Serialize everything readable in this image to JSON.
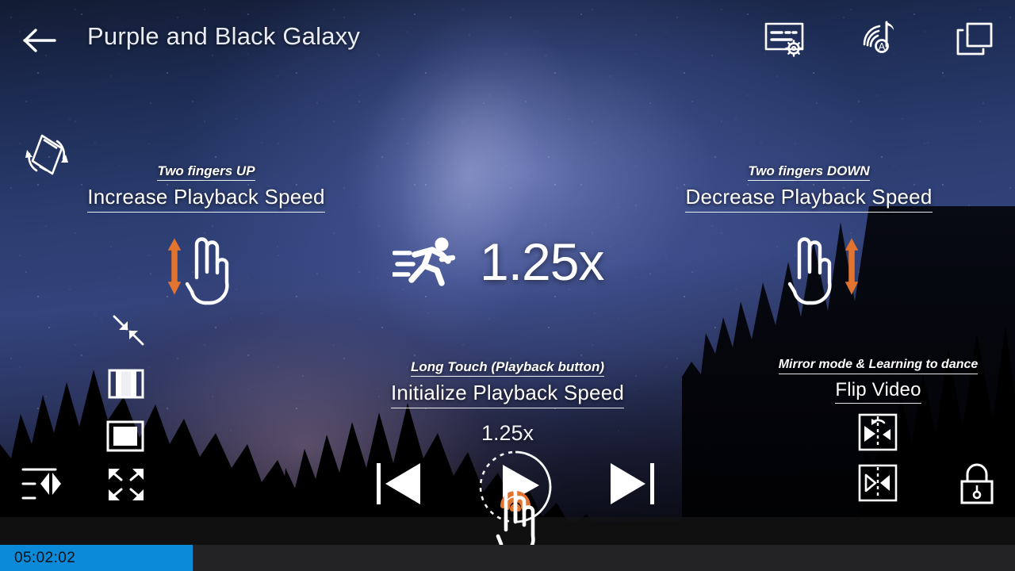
{
  "app": {
    "title": "Purple and Black Galaxy"
  },
  "topbar": {
    "back_label": "back-arrow",
    "icons": [
      {
        "name": "subtitle-settings-icon",
        "label": "Subtitle settings"
      },
      {
        "name": "audio-track-icon",
        "label": "Audio track"
      },
      {
        "name": "picture-in-picture-icon",
        "label": "Picture in picture"
      }
    ]
  },
  "hints": {
    "increase": {
      "gesture": "Two fingers UP",
      "action": "Increase Playback Speed"
    },
    "decrease": {
      "gesture": "Two fingers DOWN",
      "action": "Decrease Playback Speed"
    },
    "initialize": {
      "gesture": "Long Touch (Playback button)",
      "action": "Initialize Playback Speed",
      "value": "1.25x"
    },
    "flip": {
      "gesture": "Mirror mode &  Learning to dance",
      "action": "Flip Video"
    }
  },
  "speed": {
    "value": "1.25x",
    "icon": "running-man-icon"
  },
  "left_tools": [
    {
      "name": "screen-rotation-icon",
      "label": "Screen rotation"
    },
    {
      "name": "shrink-icon",
      "label": "Shrink"
    },
    {
      "name": "fit-width-icon",
      "label": "Fit width"
    },
    {
      "name": "crop-icon",
      "label": "Crop"
    },
    {
      "name": "expand-icon",
      "label": "Expand"
    },
    {
      "name": "equalizer-icon",
      "label": "Equalizer"
    }
  ],
  "right_tools": [
    {
      "name": "flip-rotate-icon",
      "label": "Flip and rotate"
    },
    {
      "name": "flip-horizontal-icon",
      "label": "Flip horizontal"
    },
    {
      "name": "lock-icon",
      "label": "Lock screen"
    }
  ],
  "playback": {
    "previous_label": "Previous",
    "play_label": "Play",
    "next_label": "Next",
    "touch_indicator": "touch-hand-icon"
  },
  "progress": {
    "time": "05:02:02",
    "fill_percent": 19,
    "fill_color": "#0a8ad9",
    "track_color": "#232326"
  },
  "colors": {
    "accent_orange": "#e2742f",
    "text_white": "#ffffff",
    "sky_blue": "#2b3d70"
  }
}
